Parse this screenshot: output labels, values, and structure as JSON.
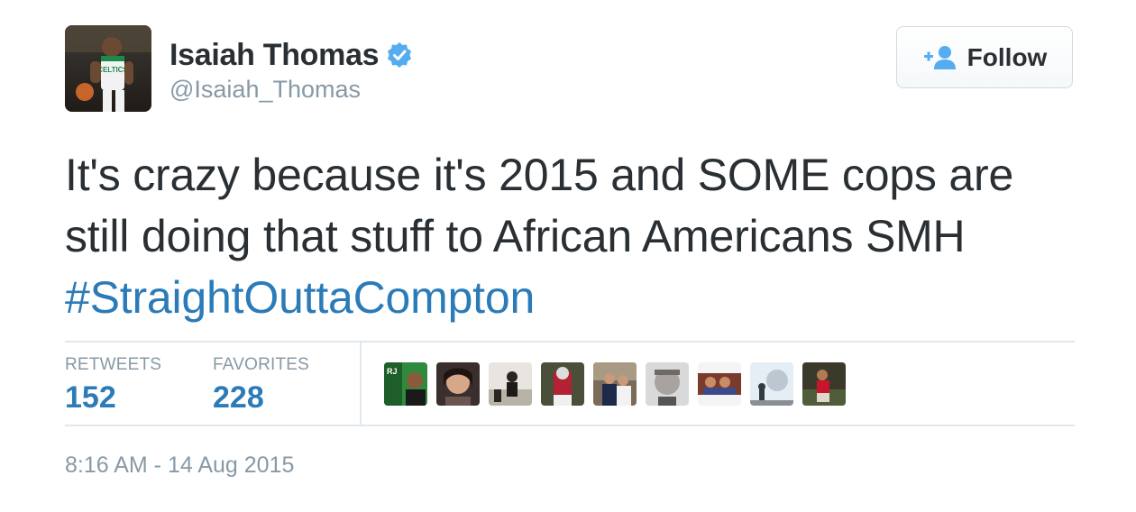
{
  "user": {
    "display_name": "Isaiah Thomas",
    "handle": "@Isaiah_Thomas",
    "verified": true,
    "avatar_icon": "profile-photo-basketball-player"
  },
  "follow_button": {
    "label": "Follow",
    "icon": "add-user-icon"
  },
  "tweet": {
    "text_before_hashtag": "It's crazy because it's 2015 and SOME cops are still doing that stuff to African Americans SMH ",
    "hashtag": "#StraightOuttaCompton"
  },
  "stats": {
    "retweets_label": "RETWEETS",
    "retweets_count": "152",
    "favorites_label": "FAVORITES",
    "favorites_count": "228"
  },
  "favoriters": [
    {
      "icon": "user-avatar-icon"
    },
    {
      "icon": "user-avatar-icon"
    },
    {
      "icon": "user-avatar-icon"
    },
    {
      "icon": "user-avatar-icon"
    },
    {
      "icon": "user-avatar-icon"
    },
    {
      "icon": "user-avatar-icon"
    },
    {
      "icon": "user-avatar-icon"
    },
    {
      "icon": "user-avatar-icon"
    },
    {
      "icon": "user-avatar-icon"
    },
    {
      "icon": "user-avatar-icon"
    }
  ],
  "timestamp": "8:16 AM - 14 Aug 2015",
  "colors": {
    "link_blue": "#2b7bb9",
    "verified_blue": "#55acee",
    "muted_gray": "#8899a6",
    "text_dark": "#292f33"
  }
}
